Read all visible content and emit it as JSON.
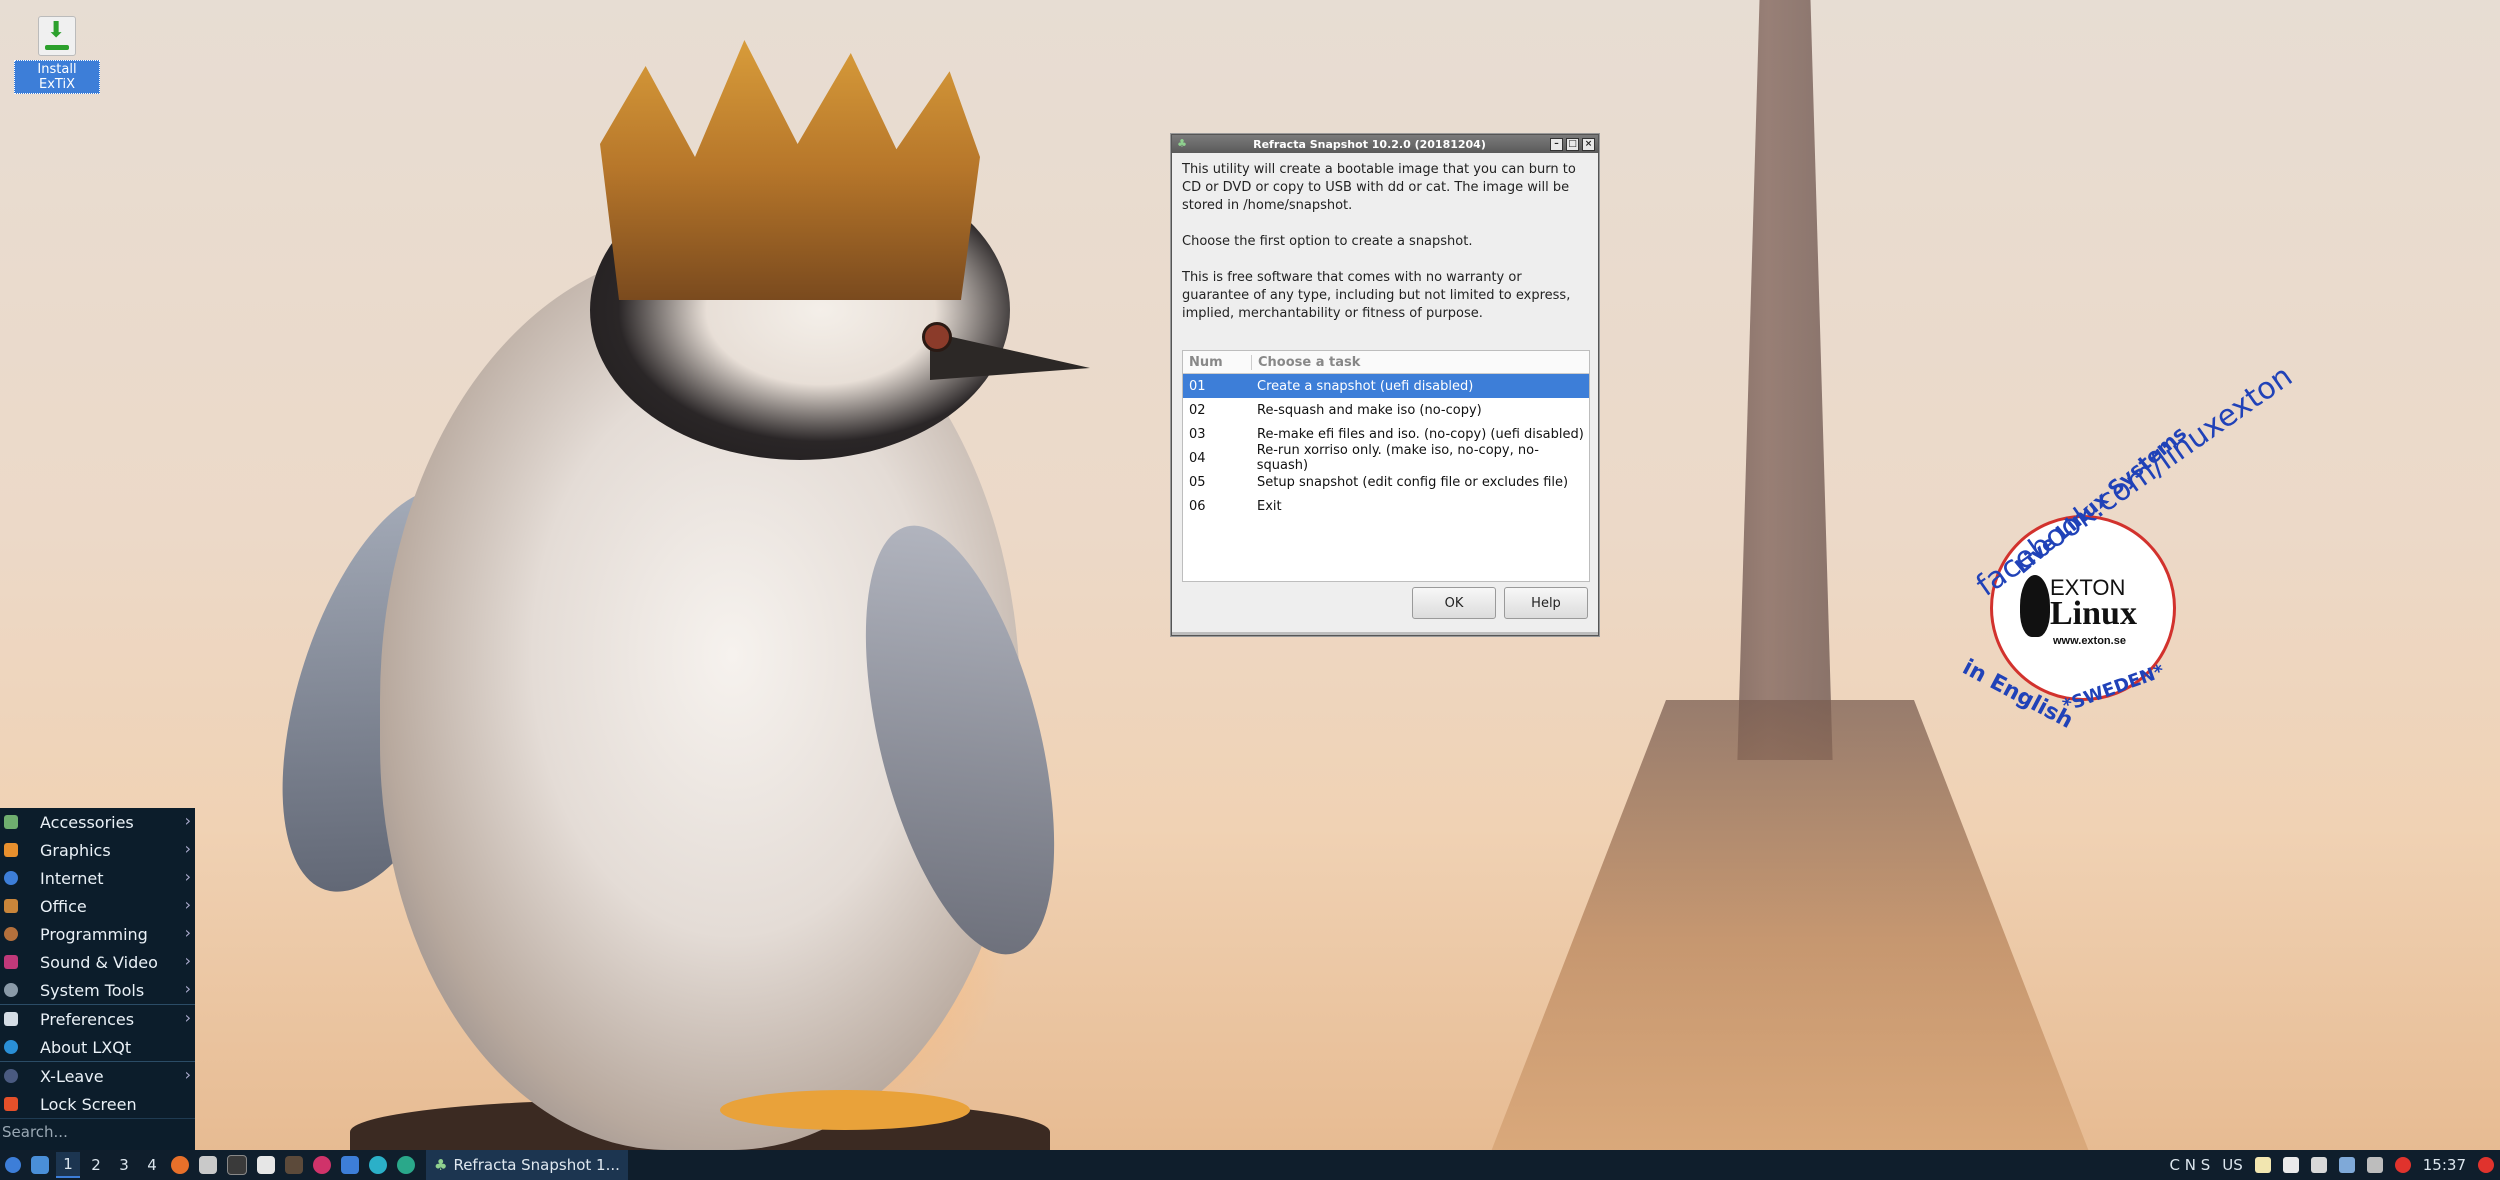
{
  "desktop": {
    "icon_label": "Install ExTiX"
  },
  "wallpaper": {
    "stamp_center_top": "EXTON",
    "stamp_center_main": "Linux",
    "stamp_site": "www.exton.se",
    "stamp_ring_top": "facebook.com/linuxexton",
    "stamp_ring_sub": "Live Linux Systems",
    "stamp_ring_bottom": "in English",
    "stamp_ring_bottom2": "*SWEDEN*"
  },
  "dialog": {
    "title": "Refracta Snapshot 10.2.0 (20181204)",
    "paragraphs": [
      "This utility will create a bootable image that you can burn to CD or DVD or copy to USB with dd or cat. The image will be stored in /home/snapshot.",
      "Choose the first option to create a snapshot.",
      "This is free software that comes with no warranty or guarantee of any type, including but not limited to express, implied, merchantability or fitness of purpose."
    ],
    "columns": [
      "Num",
      "Choose a task"
    ],
    "rows": [
      {
        "num": "01",
        "task": "Create a snapshot (uefi disabled)"
      },
      {
        "num": "02",
        "task": "Re-squash and make iso (no-copy)"
      },
      {
        "num": "03",
        "task": "Re-make efi files and iso. (no-copy) (uefi disabled)"
      },
      {
        "num": "04",
        "task": "Re-run xorriso only. (make iso, no-copy, no-squash)"
      },
      {
        "num": "05",
        "task": "Setup snapshot (edit config file or excludes file)"
      },
      {
        "num": "06",
        "task": "Exit"
      }
    ],
    "ok_label": "OK",
    "help_label": "Help"
  },
  "menu": {
    "items": [
      {
        "label": "Accessories",
        "icon": "accessories-icon",
        "color": "#6fae6f"
      },
      {
        "label": "Graphics",
        "icon": "graphics-icon",
        "color": "#e8902e"
      },
      {
        "label": "Internet",
        "icon": "internet-icon",
        "color": "#3d7ed8"
      },
      {
        "label": "Office",
        "icon": "office-icon",
        "color": "#c9853a"
      },
      {
        "label": "Programming",
        "icon": "programming-icon",
        "color": "#b4703c"
      },
      {
        "label": "Sound & Video",
        "icon": "sound-video-icon",
        "color": "#c0397a"
      },
      {
        "label": "System Tools",
        "icon": "system-tools-icon",
        "color": "#8a9aa8"
      },
      {
        "label": "Preferences",
        "icon": "preferences-icon",
        "color": "#d5dde5"
      },
      {
        "label": "About LXQt",
        "icon": "lxqt-icon",
        "color": "#2a8fd6"
      },
      {
        "label": "X-Leave",
        "icon": "leave-icon",
        "color": "#4a5a80"
      },
      {
        "label": "Lock Screen",
        "icon": "lock-icon",
        "color": "#e4502a"
      }
    ],
    "search_placeholder": "Search..."
  },
  "taskbar": {
    "workspaces": [
      "1",
      "2",
      "3",
      "4"
    ],
    "active_task": "Refracta Snapshot 1...",
    "tray_keys": "C N S",
    "keyboard_layout": "US",
    "clock": "15:37"
  },
  "colors": {
    "selection": "#3d7ed8",
    "panel": "#0f1e2c",
    "menu_bg": "#0c1d2b"
  }
}
